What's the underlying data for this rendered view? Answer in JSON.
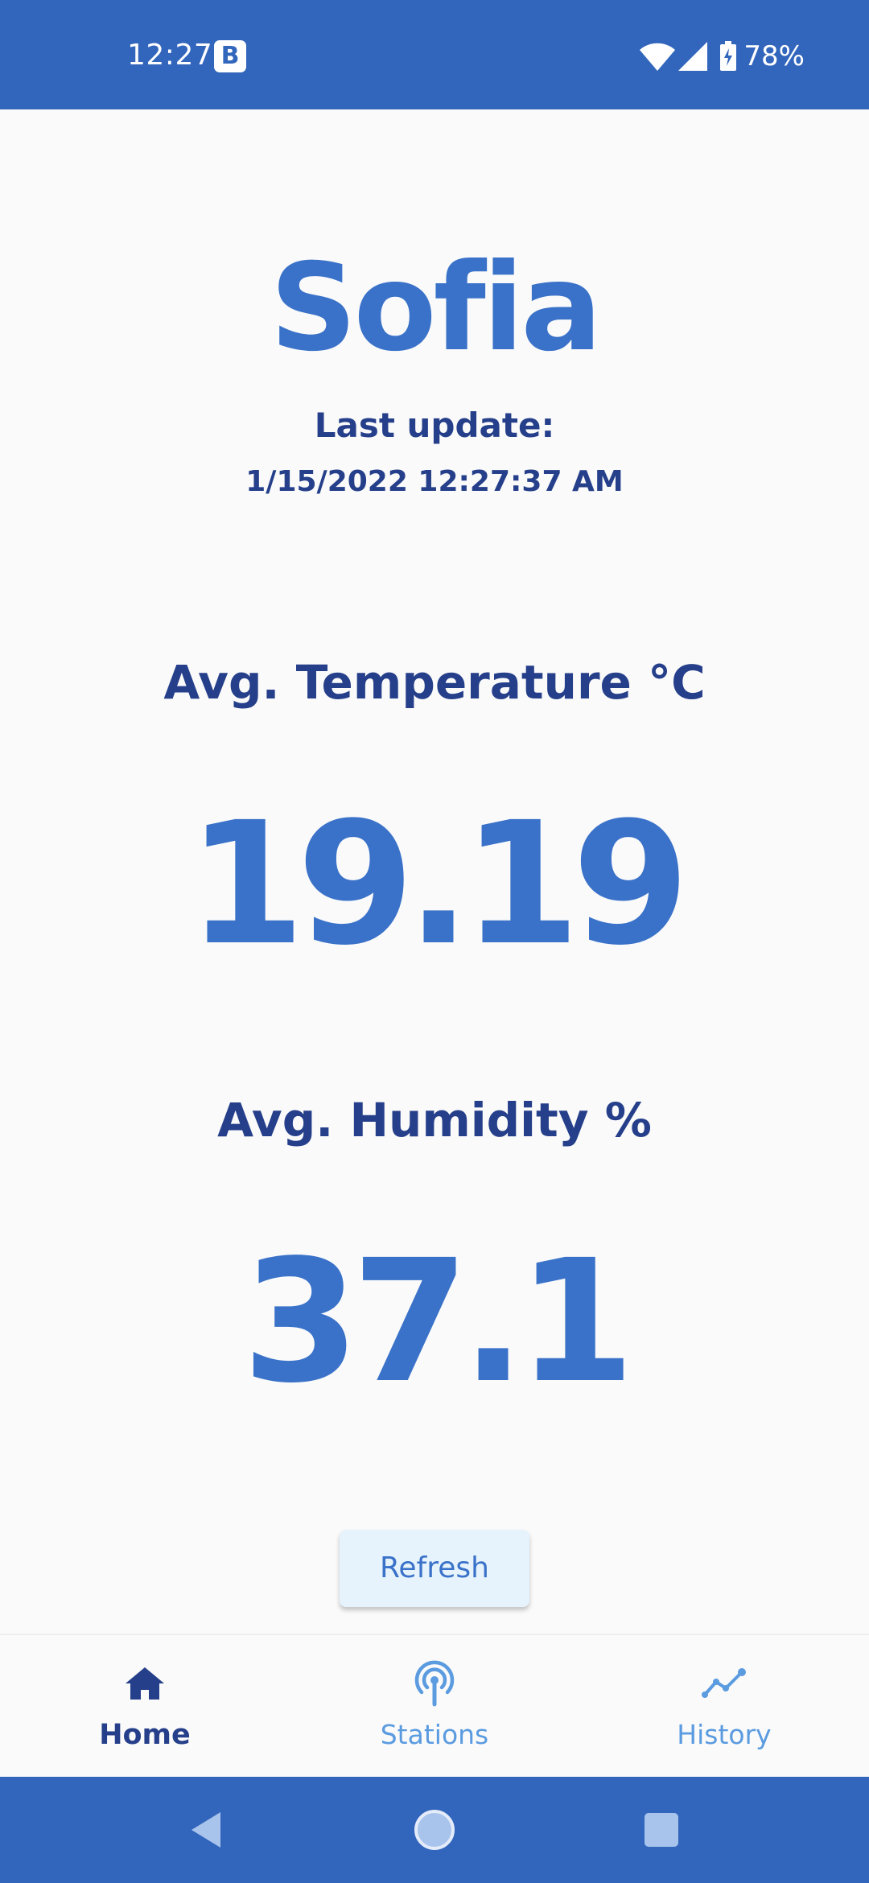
{
  "status_bar": {
    "time": "12:27",
    "app_badge": "B",
    "battery": "78%",
    "bg_color": "#3265bc"
  },
  "main": {
    "city": "Sofia",
    "last_update_label": "Last update:",
    "last_update_value": "1/15/2022 12:27:37 AM",
    "temperature_label": "Avg. Temperature °C",
    "temperature_value": "19.19",
    "humidity_label": "Avg. Humidity %",
    "humidity_value": "37.1",
    "refresh_label": "Refresh"
  },
  "bottom_nav": {
    "items": [
      {
        "label": "Home",
        "icon": "home-icon",
        "active": true
      },
      {
        "label": "Stations",
        "icon": "antenna-icon",
        "active": false
      },
      {
        "label": "History",
        "icon": "trend-line-icon",
        "active": false
      }
    ]
  },
  "system_nav": {
    "buttons": [
      "back-icon",
      "home-circle-icon",
      "recents-square-icon"
    ]
  },
  "colors": {
    "accent": "#3a72c9",
    "dark_text": "#253f8a",
    "inactive_nav": "#5b9be0",
    "button_bg": "#e6f3fc"
  }
}
